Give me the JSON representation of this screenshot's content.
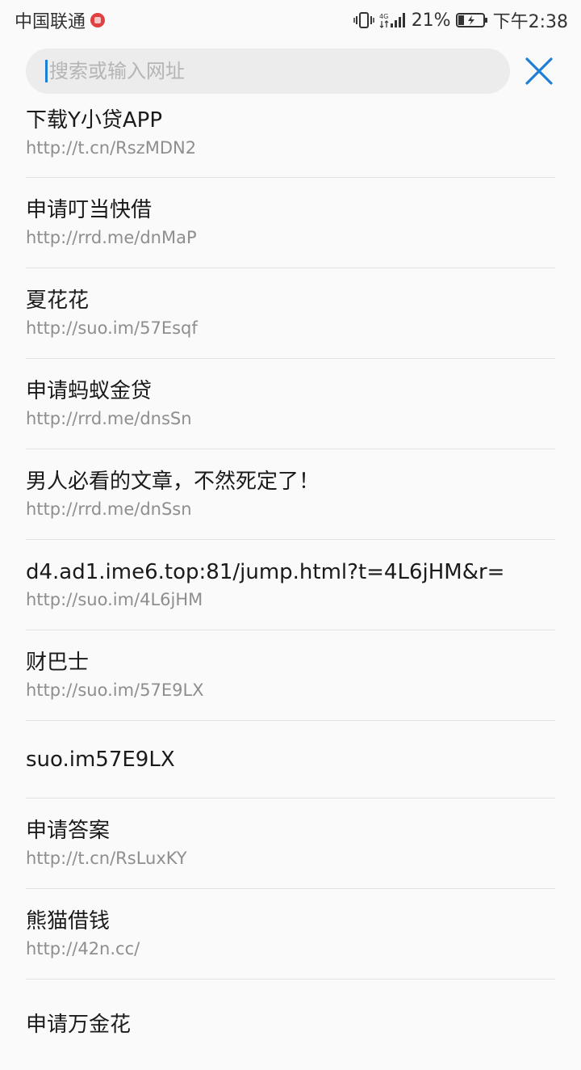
{
  "status_bar": {
    "carrier": "中国联通",
    "network": "4G",
    "battery": "21%",
    "time": "下午2:38"
  },
  "search": {
    "placeholder": "搜索或输入网址",
    "value": "",
    "accent_color": "#1e7fd6"
  },
  "suggestions": [
    {
      "title": "下载Y小贷APP",
      "url": "http://t.cn/RszMDN2"
    },
    {
      "title": "申请叮当快借",
      "url": "http://rrd.me/dnMaP"
    },
    {
      "title": "夏花花",
      "url": "http://suo.im/57Esqf"
    },
    {
      "title": "申请蚂蚁金贷",
      "url": "http://rrd.me/dnsSn"
    },
    {
      "title": "男人必看的文章，不然死定了！",
      "url": "http://rrd.me/dnSsn"
    },
    {
      "title": "d4.ad1.ime6.top:81/jump.html?t=4L6jHM&r=",
      "url": "http://suo.im/4L6jHM"
    },
    {
      "title": "财巴士",
      "url": "http://suo.im/57E9LX"
    },
    {
      "title": "suo.im57E9LX"
    },
    {
      "title": "申请答案",
      "url": "http://t.cn/RsLuxKY"
    },
    {
      "title": "熊猫借钱",
      "url": "http://42n.cc/"
    },
    {
      "title": "申请万金花"
    }
  ]
}
